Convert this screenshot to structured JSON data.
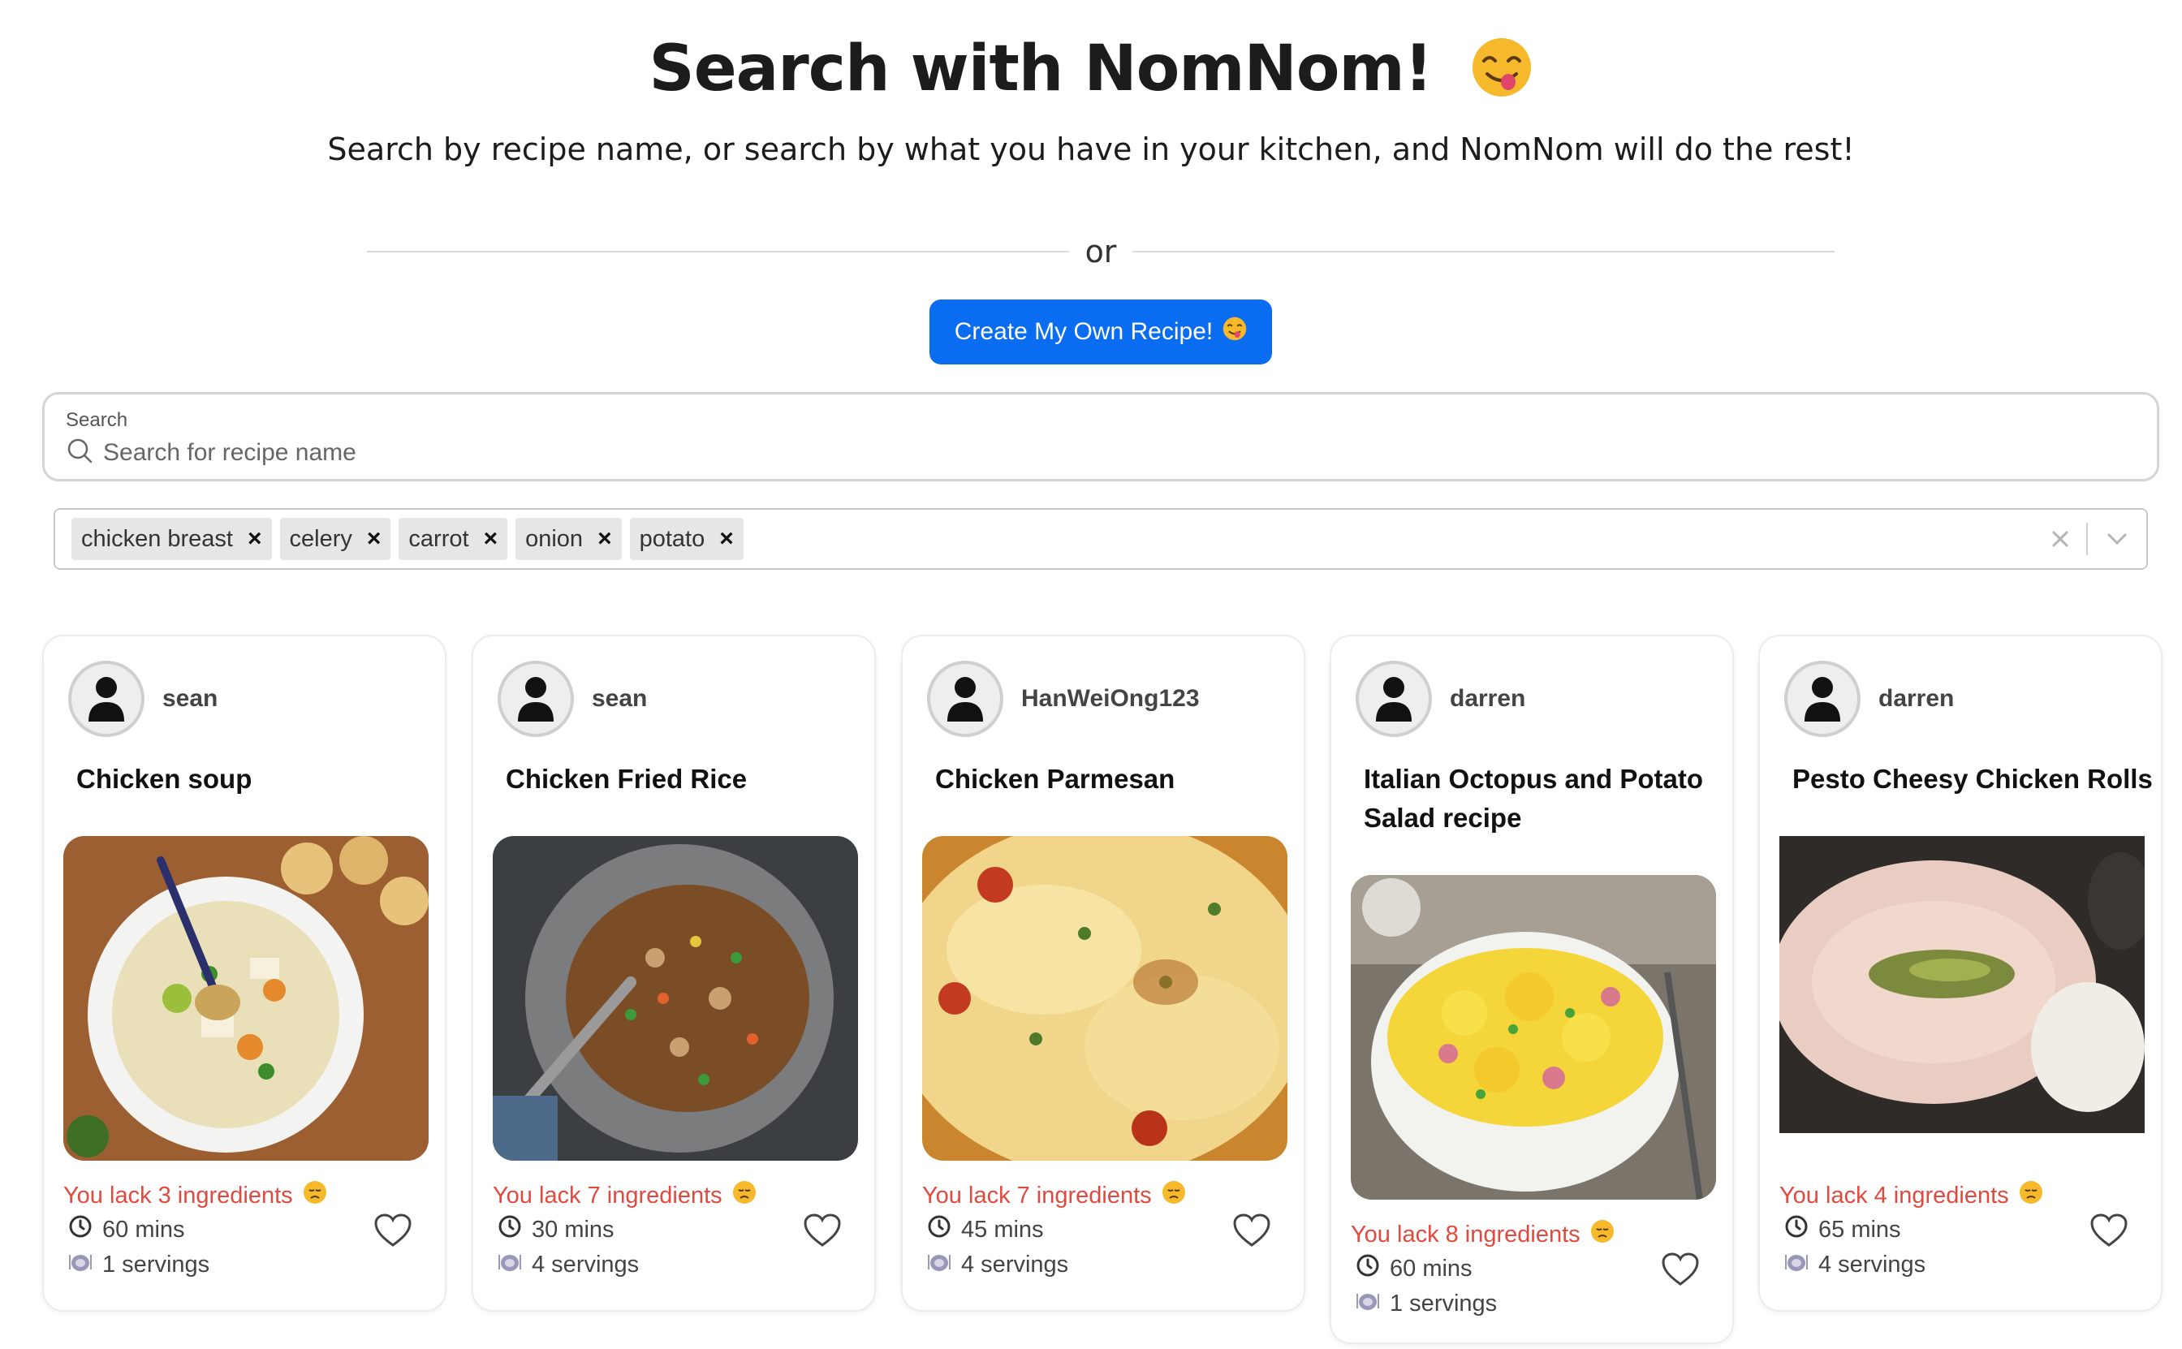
{
  "header": {
    "title": "Search with NomNom!",
    "title_emoji": "yum-face-emoji",
    "subtitle": "Search by recipe name, or search by what you have in your kitchen, and NomNom will do the rest!",
    "divider_text": "or",
    "create_button_label": "Create My Own Recipe!"
  },
  "search": {
    "label": "Search",
    "placeholder": "Search for recipe name",
    "value": ""
  },
  "ingredients": {
    "selected": [
      "chicken breast",
      "celery",
      "carrot",
      "onion",
      "potato"
    ],
    "remove_glyph": "×"
  },
  "colors": {
    "accent": "#0a6cf0",
    "warning": "#e04a3f"
  },
  "recipes": [
    {
      "author": "sean",
      "title": "Chicken soup",
      "lack": "You lack 3 ingredients",
      "time": "60 mins",
      "servings": "1 servings"
    },
    {
      "author": "sean",
      "title": "Chicken Fried Rice",
      "lack": "You lack 7 ingredients",
      "time": "30 mins",
      "servings": "4 servings"
    },
    {
      "author": "HanWeiOng123",
      "title": "Chicken Parmesan",
      "lack": "You lack 7 ingredients",
      "time": "45 mins",
      "servings": "4 servings"
    },
    {
      "author": "darren",
      "title": "Italian Octopus and Potato Salad recipe",
      "lack": "You lack 8 ingredients",
      "time": "60 mins",
      "servings": "1 servings"
    },
    {
      "author": "darren",
      "title": "Pesto Cheesy Chicken Rolls",
      "lack": "You lack 4 ingredients",
      "time": "65 mins",
      "servings": "4 servings"
    }
  ]
}
